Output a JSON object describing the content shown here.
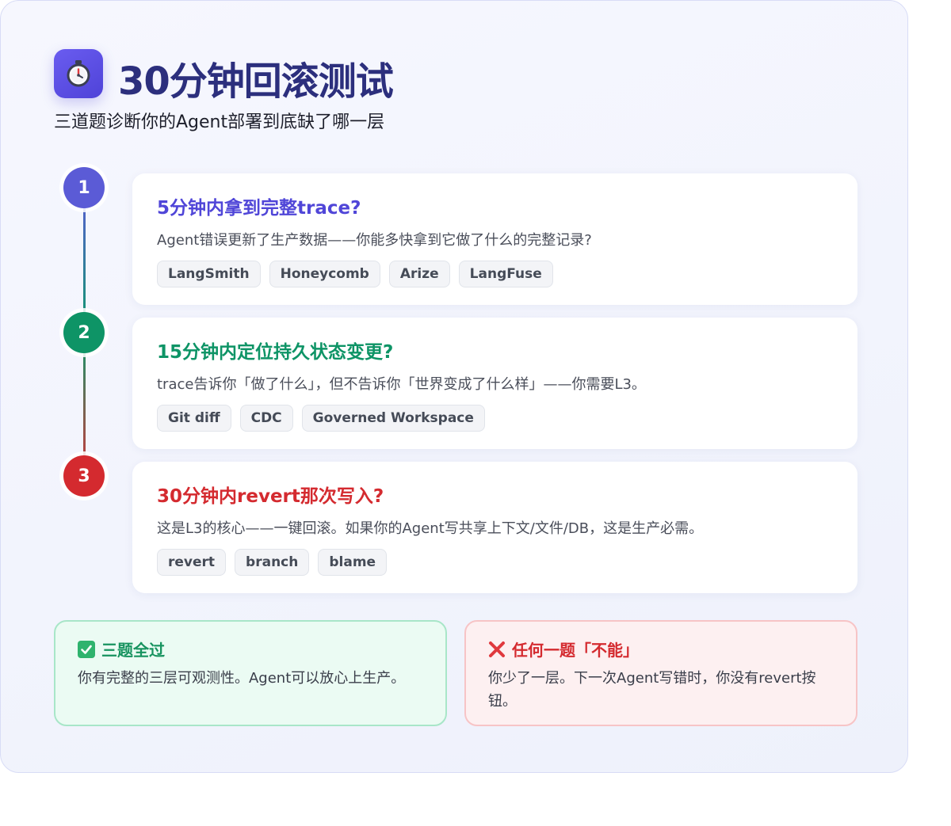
{
  "header": {
    "title": "30分钟回滚测试",
    "subtitle": "三道题诊断你的Agent部署到底缺了哪一层",
    "logo_icon": "stopwatch-icon"
  },
  "questions": [
    {
      "number": "1",
      "color": "#5046d8",
      "title": "5分钟内拿到完整trace?",
      "description": "Agent错误更新了生产数据——你能多快拿到它做了什么的完整记录?",
      "tags": [
        "LangSmith",
        "Honeycomb",
        "Arize",
        "LangFuse"
      ]
    },
    {
      "number": "2",
      "color": "#0e9466",
      "title": "15分钟内定位持久状态变更?",
      "description": "trace告诉你「做了什么」，但不告诉你「世界变成了什么样」——你需要L3。",
      "tags": [
        "Git diff",
        "CDC",
        "Governed Workspace"
      ]
    },
    {
      "number": "3",
      "color": "#d42a2f",
      "title": "30分钟内revert那次写入?",
      "description": "这是L3的核心——一键回滚。如果你的Agent写共享上下文/文件/DB，这是生产必需。",
      "tags": [
        "revert",
        "branch",
        "blame"
      ]
    }
  ],
  "results": {
    "pass": {
      "icon": "check-icon",
      "title": "三题全过",
      "text": "你有完整的三层可观测性。Agent可以放心上生产。",
      "color": "#17935f"
    },
    "fail": {
      "icon": "cross-icon",
      "title": "任何一题「不能」",
      "text": "你少了一层。下一次Agent写错时，你没有revert按钮。",
      "color": "#d42a2f"
    }
  }
}
